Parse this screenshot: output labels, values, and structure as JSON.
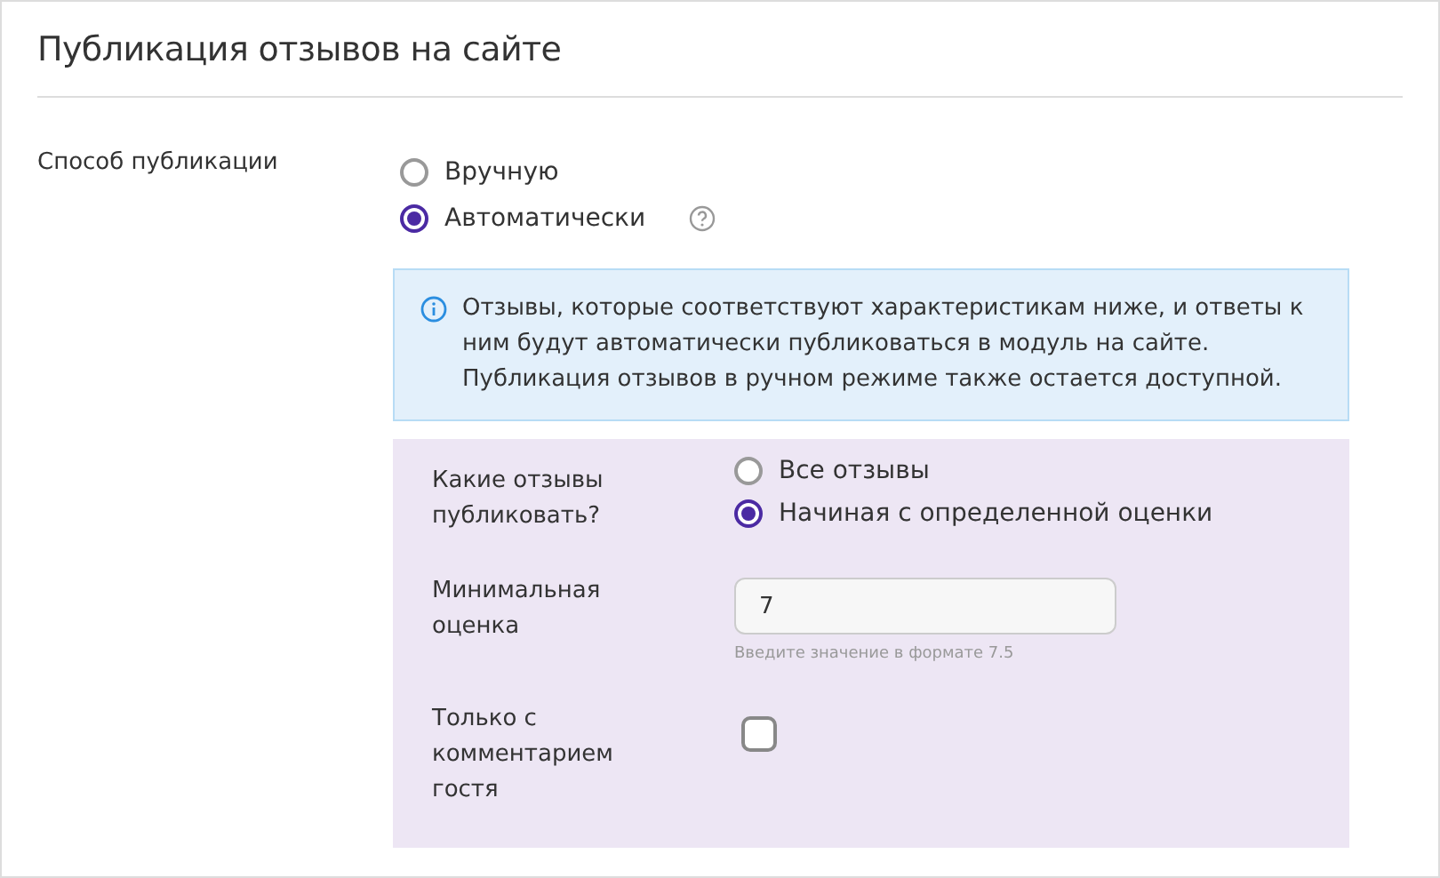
{
  "title": "Публикация отзывов на сайте",
  "method": {
    "label": "Способ публикации",
    "options": [
      {
        "label": "Вручную",
        "selected": false,
        "help": false
      },
      {
        "label": "Автоматически",
        "selected": true,
        "help": true
      }
    ]
  },
  "info": "Отзывы, которые соответствуют характеристикам ниже, и ответы к ним будут автоматически публиковаться в модуль на сайте. Публикация отзывов в ручном режиме также остается доступной.",
  "settings": [
    {
      "kind": "radio",
      "label": "Какие отзывы публиковать?",
      "options": [
        {
          "label": "Все отзывы",
          "selected": false
        },
        {
          "label": "Начиная с определенной оценки",
          "selected": true
        }
      ]
    },
    {
      "kind": "input",
      "label": "Минимальная оценка",
      "value": "7",
      "hint": "Введите значение в формате 7.5"
    },
    {
      "kind": "checkbox",
      "label": "Только с комментарием гостя",
      "checked": false
    }
  ]
}
